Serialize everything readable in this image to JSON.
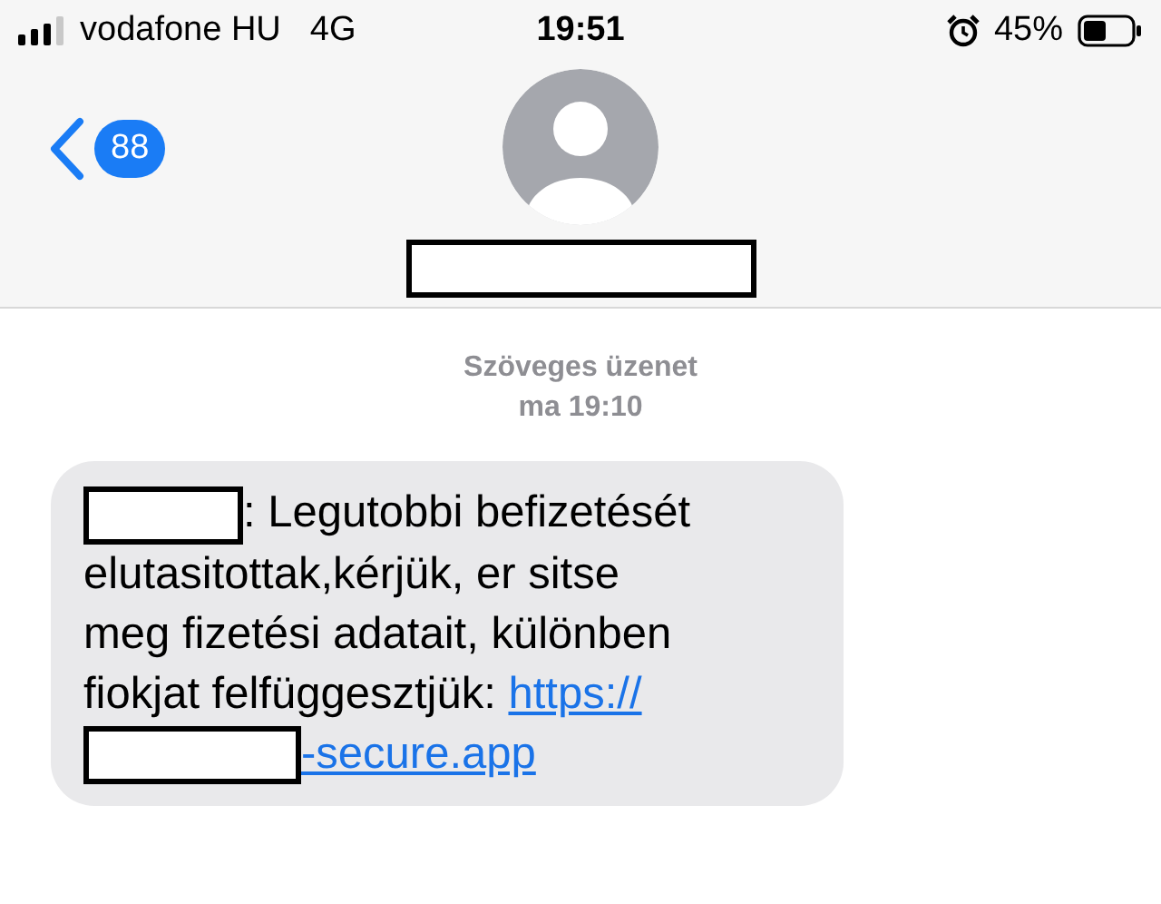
{
  "status_bar": {
    "carrier": "vodafone HU",
    "network": "4G",
    "time": "19:51",
    "battery": "45%"
  },
  "header": {
    "back_count": "88"
  },
  "thread": {
    "label": "Szöveges üzenet",
    "time": "ma 19:10"
  },
  "message": {
    "segments": [
      {
        "kind": "redaction"
      },
      {
        "kind": "text",
        "text": ": Legutobbi befizetését"
      },
      {
        "kind": "break"
      },
      {
        "kind": "text",
        "text": "elutasitottak,kérjük, er sitse"
      },
      {
        "kind": "break"
      },
      {
        "kind": "text",
        "text": "meg fizetési adatait, különben"
      },
      {
        "kind": "break"
      },
      {
        "kind": "text",
        "text": "fiokjat felfüggesztjük: "
      },
      {
        "kind": "link",
        "text": "https://"
      },
      {
        "kind": "break"
      },
      {
        "kind": "redaction"
      },
      {
        "kind": "link",
        "text": "-secure.app"
      }
    ]
  }
}
